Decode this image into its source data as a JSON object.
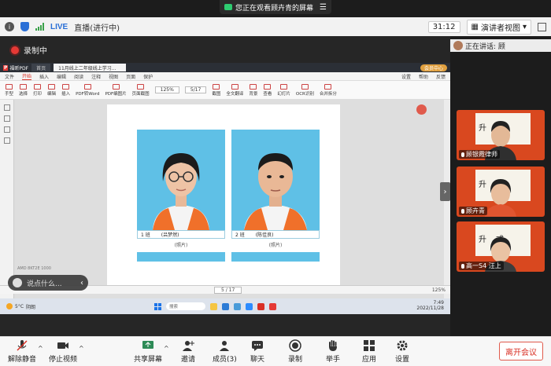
{
  "banner": {
    "text": "您正在观看顾卉青的屏幕"
  },
  "meeting_bar": {
    "live": "LIVE",
    "live_status": "直播(进行中)",
    "timer": "31:12",
    "view_mode": "演讲者视图"
  },
  "recording": {
    "label": "录制中"
  },
  "pdf_app": {
    "app_name": "福昕PDF",
    "tabs": [
      "首页",
      "11月线上二年级线上学习..."
    ],
    "member_btn": "会员中心",
    "menu": [
      "文件",
      "开始",
      "插入",
      "编辑",
      "阅读",
      "注释",
      "视图",
      "页面",
      "保护"
    ],
    "menu_active": "开始",
    "menu_right": [
      "设置",
      "帮助",
      "反馈"
    ],
    "tools": [
      "手型",
      "选择",
      "打印",
      "编辑",
      "插入",
      "PDF转Word",
      "PDF编图片",
      "页面截图"
    ],
    "zoom": "125%",
    "page": "5/17",
    "tools_right": [
      "截图",
      "全文翻译",
      "背景",
      "查看",
      "幻灯片",
      "OCR识别",
      "合并拆分"
    ],
    "students": [
      {
        "cls": "1 班",
        "name": "(吕梦然)",
        "sub": "(照片)"
      },
      {
        "cls": "2 班",
        "name": "(陈佳良)",
        "sub": "(照片)"
      }
    ],
    "status_page": "5 / 17",
    "status_zoom": "125%",
    "side_hint": "AMD 8KT2E 1000"
  },
  "taskbar": {
    "weather_temp": "5°C",
    "weather_desc": "阴朗",
    "search": "搜索",
    "time": "7:49",
    "date": "2022/11/28"
  },
  "chat": {
    "placeholder": "说点什么..."
  },
  "speaking": {
    "label": "正在讲话: 顾"
  },
  "participants": [
    {
      "name": "顾银霞律师"
    },
    {
      "name": "顾卉青"
    },
    {
      "name": "高一S4 汪上"
    }
  ],
  "toolbar": {
    "unmute": "解除静音",
    "start_video": "停止视频",
    "share_screen": "共享屏幕",
    "invite": "邀请",
    "members": "成员(3)",
    "chat": "聊天",
    "record": "录制",
    "raise_hand": "举手",
    "apps": "应用",
    "settings": "设置",
    "leave": "离开会议"
  },
  "colors": {
    "accent_red": "#d93025",
    "photo_bg": "#5fc0e6",
    "tile_bg": "#d9481f"
  }
}
